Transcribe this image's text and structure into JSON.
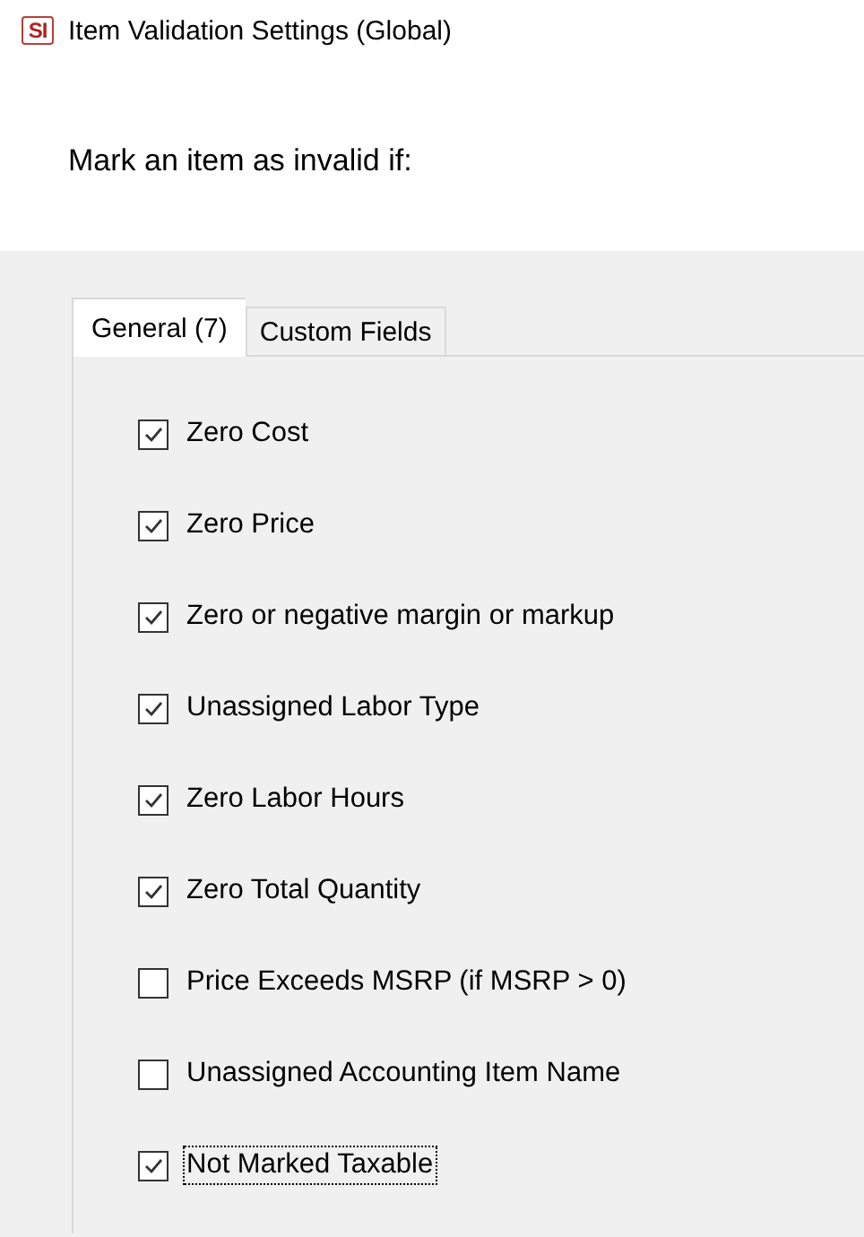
{
  "window": {
    "title": "Item Validation Settings (Global)",
    "icon_text": "SI"
  },
  "heading": "Mark an item as invalid if:",
  "tabs": [
    {
      "label": "General (7)",
      "selected": true
    },
    {
      "label": "Custom Fields",
      "selected": false
    }
  ],
  "options": [
    {
      "label": "Zero Cost",
      "checked": true,
      "focused": false
    },
    {
      "label": "Zero Price",
      "checked": true,
      "focused": false
    },
    {
      "label": "Zero or negative margin or markup",
      "checked": true,
      "focused": false
    },
    {
      "label": "Unassigned Labor Type",
      "checked": true,
      "focused": false
    },
    {
      "label": "Zero Labor Hours",
      "checked": true,
      "focused": false
    },
    {
      "label": "Zero Total Quantity",
      "checked": true,
      "focused": false
    },
    {
      "label": "Price Exceeds MSRP (if MSRP > 0)",
      "checked": false,
      "focused": false
    },
    {
      "label": "Unassigned Accounting Item Name",
      "checked": false,
      "focused": false
    },
    {
      "label": "Not Marked Taxable",
      "checked": true,
      "focused": true
    }
  ]
}
